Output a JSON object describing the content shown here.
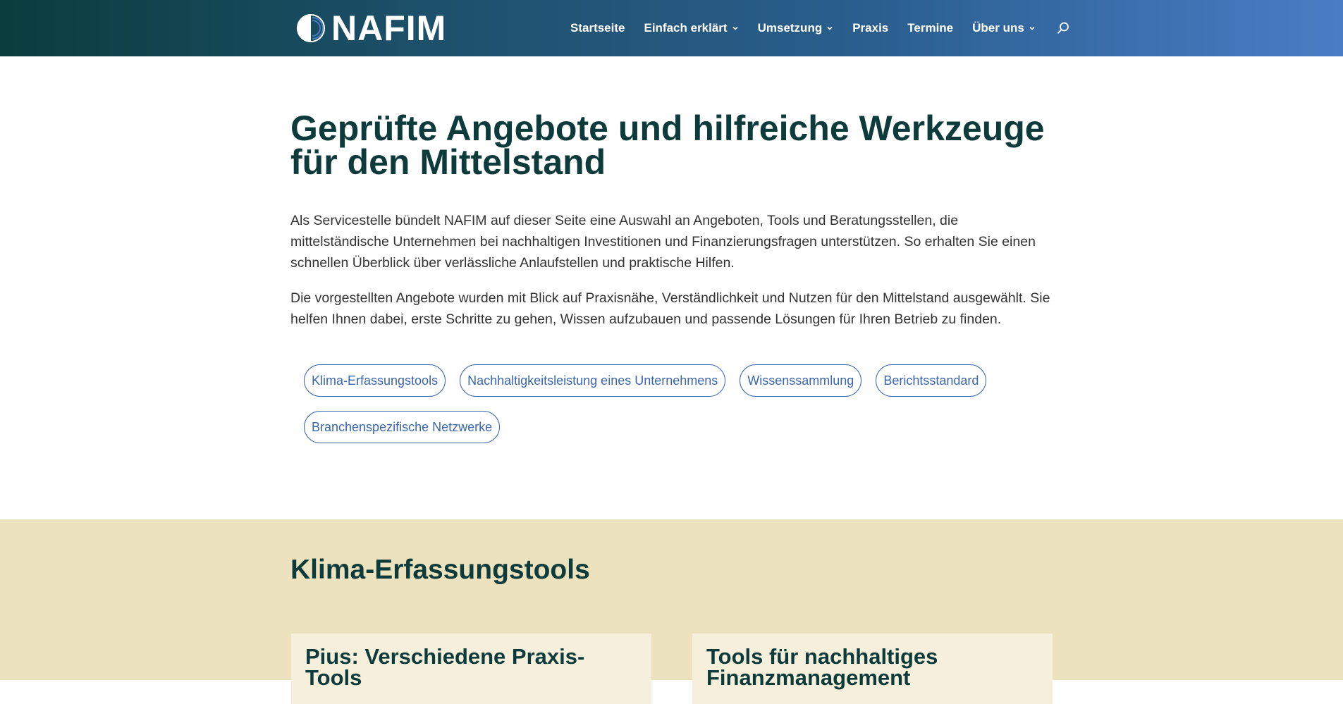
{
  "header": {
    "logo_text": "NAFIM",
    "nav": [
      {
        "label": "Startseite",
        "has_dropdown": false
      },
      {
        "label": "Einfach erklärt",
        "has_dropdown": true
      },
      {
        "label": "Umsetzung",
        "has_dropdown": true
      },
      {
        "label": "Praxis",
        "has_dropdown": false
      },
      {
        "label": "Termine",
        "has_dropdown": false
      },
      {
        "label": "Über uns",
        "has_dropdown": true
      }
    ],
    "search_icon": "search-icon",
    "colors": {
      "gradient_start": "#0a3d3d",
      "gradient_end": "#4a7cc6"
    }
  },
  "intro": {
    "title": "Geprüfte Angebote und hilfreiche Werkzeuge für den Mittelstand",
    "paragraphs": [
      "Als Servicestelle bündelt NAFIM auf dieser Seite eine Auswahl an Angeboten, Tools und Beratungsstellen, die mittelständische Unternehmen bei nachhaltigen Investitionen und Finanzierungsfragen unterstützen. So erhalten Sie einen schnellen Überblick über verlässliche Anlaufstellen und praktische Hilfen.",
      "Die vorgestellten Angebote wurden mit Blick auf Praxisnähe, Verständlichkeit und Nutzen für den Mittelstand ausgewählt. Sie helfen Ihnen dabei, erste Schritte zu gehen, Wissen aufzubauen und passende Lösungen für Ihren Betrieb zu finden."
    ],
    "tags": [
      "Klima-Erfassungstools",
      "Nachhaltigkeitsleistung eines Unternehmens",
      "Wissenssammlung",
      "Berichtsstandard",
      "Branchenspezifische Netzwerke"
    ]
  },
  "section": {
    "title": "Klima-Erfassungstools",
    "cards": [
      {
        "title": "Pius: Verschiedene Praxis-Tools"
      },
      {
        "title": "Tools für nachhaltiges Finanzmanagement"
      }
    ],
    "colors": {
      "background": "#ece2bd",
      "card": "#f6efdb",
      "heading": "#0d3b3b"
    }
  },
  "accent_color": "#3a66b0"
}
